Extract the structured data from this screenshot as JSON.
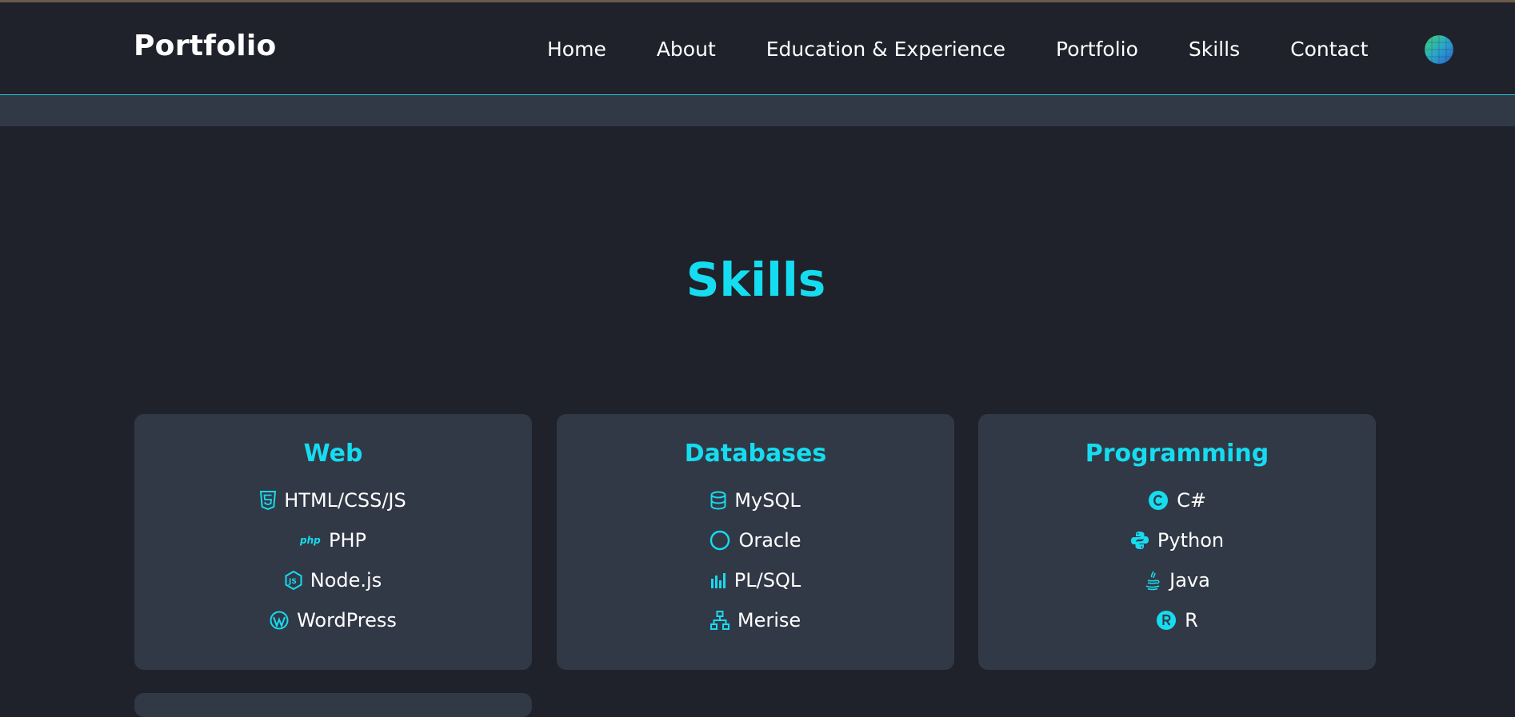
{
  "navbar": {
    "brand": "Portfolio",
    "links": [
      "Home",
      "About",
      "Education & Experience",
      "Portfolio",
      "Skills",
      "Contact"
    ],
    "theme_toggle_icon": "globe-icon"
  },
  "section": {
    "title": "Skills"
  },
  "colors": {
    "accent": "#16dcf0",
    "background": "#1f222b",
    "card": "#323946",
    "text": "#ffffff"
  },
  "cards": [
    {
      "title": "Web",
      "skills": [
        {
          "label": "HTML/CSS/JS",
          "icon": "html5-icon"
        },
        {
          "label": "PHP",
          "icon": "php-icon"
        },
        {
          "label": "Node.js",
          "icon": "nodejs-icon"
        },
        {
          "label": "WordPress",
          "icon": "wordpress-icon"
        }
      ]
    },
    {
      "title": "Databases",
      "skills": [
        {
          "label": "MySQL",
          "icon": "database-icon"
        },
        {
          "label": "Oracle",
          "icon": "circle-icon"
        },
        {
          "label": "PL/SQL",
          "icon": "bar-chart-icon"
        },
        {
          "label": "Merise",
          "icon": "sitemap-icon"
        }
      ]
    },
    {
      "title": "Programming",
      "skills": [
        {
          "label": "C#",
          "icon": "copyright-icon"
        },
        {
          "label": "Python",
          "icon": "python-icon"
        },
        {
          "label": "Java",
          "icon": "java-icon"
        },
        {
          "label": "R",
          "icon": "registered-icon"
        }
      ]
    }
  ]
}
